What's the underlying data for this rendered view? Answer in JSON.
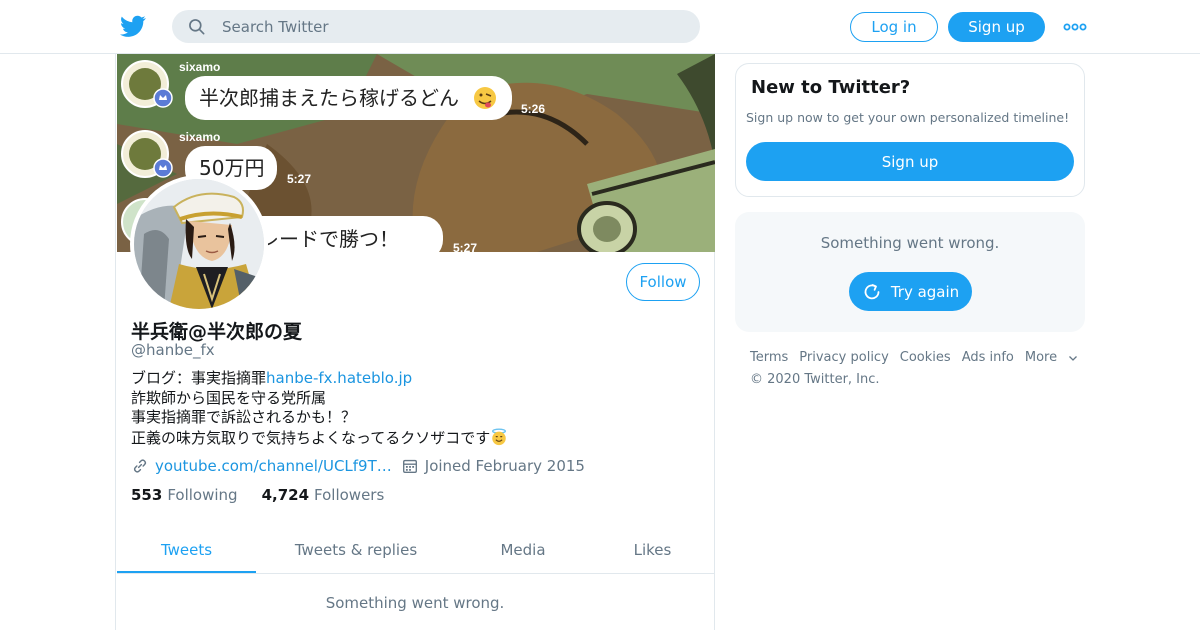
{
  "nav": {
    "logo_icon": "twitter-bird-icon",
    "search_placeholder": "Search Twitter",
    "login_label": "Log in",
    "signup_label": "Sign up",
    "more_icon": "more-dots-icon"
  },
  "banner": {
    "messages": [
      {
        "sender": "sixamo",
        "text": "半次郎捕まえたら稼げるどん",
        "emoji": "face-savoring-food",
        "time": "5:26"
      },
      {
        "sender": "sixamo",
        "text": "50万円",
        "time": "5:27"
      },
      {
        "sender": "",
        "text": "トレードで勝つ！",
        "time": "5:27"
      }
    ]
  },
  "profile": {
    "name": "半兵衛@半次郎の夏",
    "handle": "@hanbe_fx",
    "follow_label": "Follow",
    "bio": {
      "line1_prefix": "ブログ：事実指摘罪",
      "line1_link": "hanbe-fx.hateblo.jp",
      "line2": "詐欺師から国民を守る党所属",
      "line3": "事実指摘罪で訴訟されるかも！？",
      "line4": "正義の味方気取りで気持ちよくなってるクソザコです",
      "line4_emoji": "smiling-face-with-halo"
    },
    "website": "youtube.com/channel/UCLf9T…",
    "joined": "Joined February 2015",
    "following_count": "553",
    "following_label": "Following",
    "followers_count": "4,724",
    "followers_label": "Followers"
  },
  "tabs": [
    {
      "label": "Tweets",
      "active": true
    },
    {
      "label": "Tweets & replies",
      "active": false
    },
    {
      "label": "Media",
      "active": false
    },
    {
      "label": "Likes",
      "active": false
    }
  ],
  "timeline": {
    "error": "Something went wrong."
  },
  "sidebar": {
    "new_title": "New to Twitter?",
    "new_desc": "Sign up now to get your own personalized timeline!",
    "signup_label": "Sign up",
    "error_text": "Something went wrong.",
    "retry_label": "Try again"
  },
  "footer": {
    "links": [
      "Terms",
      "Privacy policy",
      "Cookies",
      "Ads info",
      "More"
    ],
    "copyright": "© 2020 Twitter, Inc."
  },
  "colors": {
    "accent": "#1da1f2",
    "link": "#1b95e0",
    "muted": "#657786",
    "border": "#e1e8ed"
  }
}
